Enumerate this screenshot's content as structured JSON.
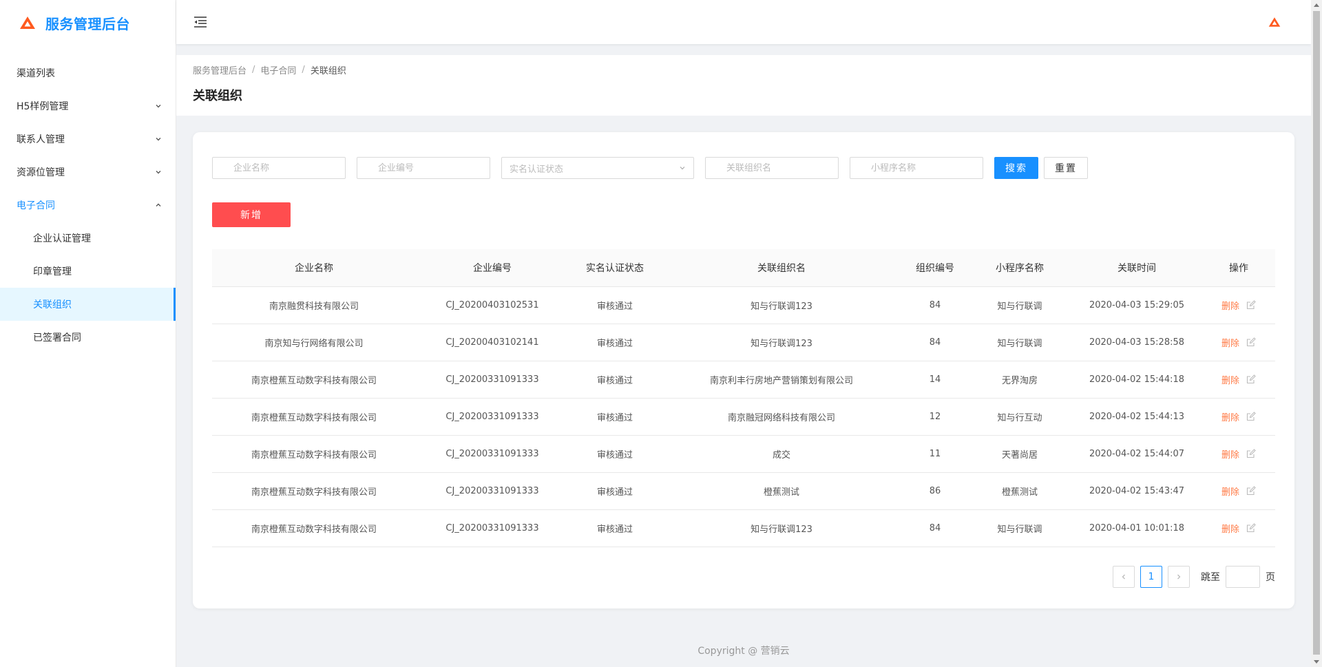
{
  "app": {
    "title": "服务管理后台"
  },
  "sidebar": {
    "items": [
      {
        "label": "渠道列表",
        "type": "item"
      },
      {
        "label": "H5样例管理",
        "type": "group",
        "expanded": false
      },
      {
        "label": "联系人管理",
        "type": "group",
        "expanded": false
      },
      {
        "label": "资源位管理",
        "type": "group",
        "expanded": false
      },
      {
        "label": "电子合同",
        "type": "group",
        "expanded": true
      },
      {
        "label": "企业认证管理",
        "type": "sub"
      },
      {
        "label": "印章管理",
        "type": "sub"
      },
      {
        "label": "关联组织",
        "type": "sub",
        "active": true
      },
      {
        "label": "已签署合同",
        "type": "sub"
      }
    ]
  },
  "breadcrumb": {
    "items": [
      "服务管理后台",
      "电子合同",
      "关联组织"
    ],
    "separator": "/"
  },
  "page": {
    "title": "关联组织"
  },
  "filters": {
    "company_name_placeholder": "企业名称",
    "company_code_placeholder": "企业编号",
    "auth_status_placeholder": "实名认证状态",
    "org_name_placeholder": "关联组织名",
    "miniprogram_placeholder": "小程序名称",
    "search_label": "搜索",
    "reset_label": "重置"
  },
  "actions": {
    "add_label": "新增"
  },
  "table": {
    "columns": [
      "企业名称",
      "企业编号",
      "实名认证状态",
      "关联组织名",
      "组织编号",
      "小程序名称",
      "关联时间",
      "操作"
    ],
    "rows": [
      [
        "南京融贯科技有限公司",
        "CJ_20200403102531",
        "审核通过",
        "知与行联调123",
        "84",
        "知与行联调",
        "2020-04-03 15:29:05"
      ],
      [
        "南京知与行网络有限公司",
        "CJ_20200403102141",
        "审核通过",
        "知与行联调123",
        "84",
        "知与行联调",
        "2020-04-03 15:28:58"
      ],
      [
        "南京橙蕉互动数字科技有限公司",
        "CJ_20200331091333",
        "审核通过",
        "南京利丰行房地产营销策划有限公司",
        "14",
        "无界淘房",
        "2020-04-02 15:44:18"
      ],
      [
        "南京橙蕉互动数字科技有限公司",
        "CJ_20200331091333",
        "审核通过",
        "南京融冠网络科技有限公司",
        "12",
        "知与行互动",
        "2020-04-02 15:44:13"
      ],
      [
        "南京橙蕉互动数字科技有限公司",
        "CJ_20200331091333",
        "审核通过",
        "成交",
        "11",
        "天著尚居",
        "2020-04-02 15:44:07"
      ],
      [
        "南京橙蕉互动数字科技有限公司",
        "CJ_20200331091333",
        "审核通过",
        "橙蕉测试",
        "86",
        "橙蕉测试",
        "2020-04-02 15:43:47"
      ],
      [
        "南京橙蕉互动数字科技有限公司",
        "CJ_20200331091333",
        "审核通过",
        "知与行联调123",
        "84",
        "知与行联调",
        "2020-04-01 10:01:18"
      ]
    ],
    "row_action_label": "删除"
  },
  "pagination": {
    "current_page": "1",
    "jump_label": "跳至",
    "page_suffix": "页"
  },
  "footer": {
    "text": "Copyright @ 营销云"
  },
  "colors": {
    "primary": "#1890ff",
    "danger": "#ff4d4f",
    "link_warn": "#ff7a45",
    "logo": "#ff5a1f"
  },
  "icons": {
    "logo": "logo-icon",
    "menu_fold": "menu-fold-icon",
    "edit": "edit-icon",
    "chevron_down": "chevron-down-icon",
    "chevron_up": "chevron-up-icon"
  }
}
